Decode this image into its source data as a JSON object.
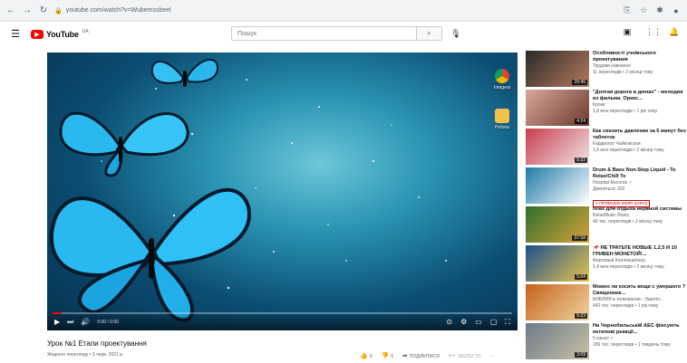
{
  "browser": {
    "url": "youtube.com/watch?v=Wubemssbeel"
  },
  "youtube": {
    "logo_text": "YouTube",
    "logo_country": "UA",
    "search_placeholder": "Пошук"
  },
  "player": {
    "time": "0:00 / 0:00",
    "progress_fraction": 0.02,
    "desktop_icons": [
      {
        "label": "Integeat"
      },
      {
        "label": "Poforia"
      }
    ]
  },
  "video": {
    "title": "Урок №1 Етапи проектування",
    "meta": "Жодного перегляду • 3 черв. 2021 р.",
    "likes": "0",
    "dislikes": "0",
    "share": "ПОДІЛИТИСЯ",
    "save": "ЗБЕРЕГТИ",
    "more": "..."
  },
  "recommendations": [
    {
      "title": "Особливості учнівського проектування",
      "channel": "Трудове навчання",
      "stats": "11 переглядів • 2 місяці тому",
      "duration": "20:45",
      "colors": [
        "#2a2a2a",
        "#b47a5c"
      ]
    },
    {
      "title": "\"Долгая дорога в дюнах\" - мелодия из фильма. Оркес...",
      "channel": "Кроки",
      "stats": "1,8 млн переглядів • 1 рік тому",
      "duration": "4:24",
      "colors": [
        "#d9a79c",
        "#6b3a2d"
      ]
    },
    {
      "title": "Как снизить давление за 5 минут без таблеток",
      "channel": "Кардиолог Чайковская",
      "stats": "1,5 млн переглядів • 2 місяці тому",
      "duration": "5:22",
      "colors": [
        "#c73d4f",
        "#f2e4e4"
      ]
    },
    {
      "title": "Drum & Bass Non-Stop Liquid - To Relax/Chill To",
      "channel": "Hospital Records ✓",
      "stats": "Дивляться: 202",
      "live": "У ПРЯМОМУ ЕФІРІ ЗАРАЗ",
      "duration": "",
      "colors": [
        "#1f7aa8",
        "#ffffff"
      ]
    },
    {
      "title": "relax для отдыха нервной системы",
      "channel": "RelaxMusic Rainy",
      "stats": "40 тис. переглядів • 2 місяці тому",
      "duration": "37:58",
      "colors": [
        "#2e6f2c",
        "#d6a23a"
      ]
    },
    {
      "title": "📌 НЕ ТРАТЬТЕ НОВЫЕ 1,2,5 И 10 ГРИВЕН МОНЕТОЙ!...",
      "channel": "Фартовый Коллекционер",
      "stats": "1,4 млн переглядів • 2 місяці тому",
      "duration": "5:04",
      "colors": [
        "#1d4f8f",
        "#e4c54a"
      ]
    },
    {
      "title": "Можно ли косить вещи с умершего ? Священник...",
      "channel": "БИБЛИЯ в толковании - Экзегет...",
      "stats": "442 тис. переглядів • 1 рік тому",
      "duration": "5:23",
      "colors": [
        "#c4621c",
        "#f0d5a0"
      ]
    },
    {
      "title": "На Чорнобильській АЕС фіксують нетипові реакції...",
      "channel": "5 канал ✓",
      "stats": "186 тис. переглядів • 1 тиждень тому",
      "duration": "3:09",
      "colors": [
        "#6b7c8a",
        "#c9c1a5"
      ]
    }
  ]
}
